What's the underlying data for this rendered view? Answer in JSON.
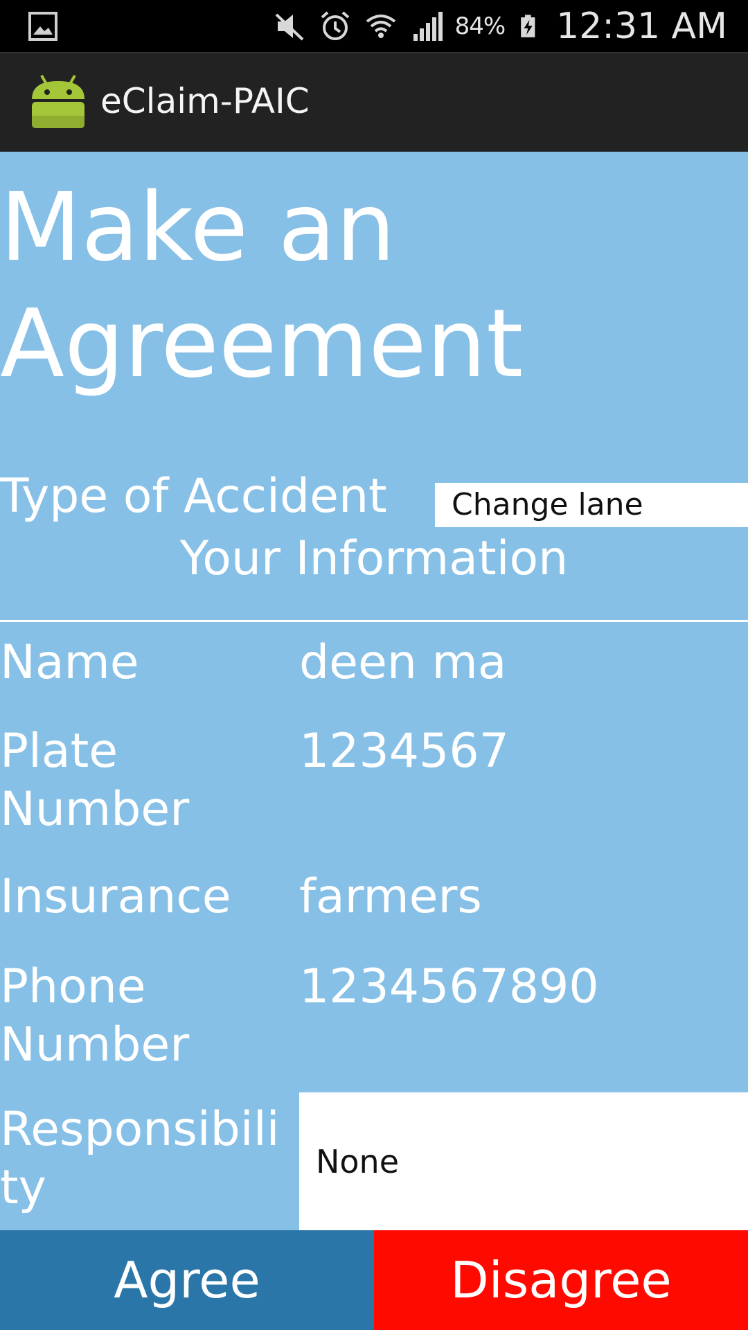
{
  "status_bar": {
    "battery_percent": "84%",
    "time": "12:31 AM",
    "icons": [
      "gallery-icon",
      "mute-icon",
      "alarm-icon",
      "wifi-icon",
      "signal-icon",
      "battery-charging-icon"
    ]
  },
  "action_bar": {
    "title": "eClaim-PAIC",
    "icon": "android-icon"
  },
  "page": {
    "title": "Make an Agreement",
    "accident_label": "Type of Accident",
    "accident_value": "Change lane",
    "section_header": "Your Information"
  },
  "info": {
    "name_label": "Name",
    "name_value": "deen ma",
    "plate_label": "Plate Number",
    "plate_value": "1234567",
    "insurance_label": "Insurance",
    "insurance_value": "farmers",
    "phone_label": "Phone Number",
    "phone_value": "1234567890",
    "responsibility_label": "Responsibility",
    "responsibility_value": "None"
  },
  "buttons": {
    "agree": "Agree",
    "disagree": "Disagree"
  },
  "colors": {
    "content_bg": "#86c0e7",
    "agree_bg": "#2a76a8",
    "disagree_bg": "#ff0a00",
    "action_bar_bg": "#222222"
  }
}
